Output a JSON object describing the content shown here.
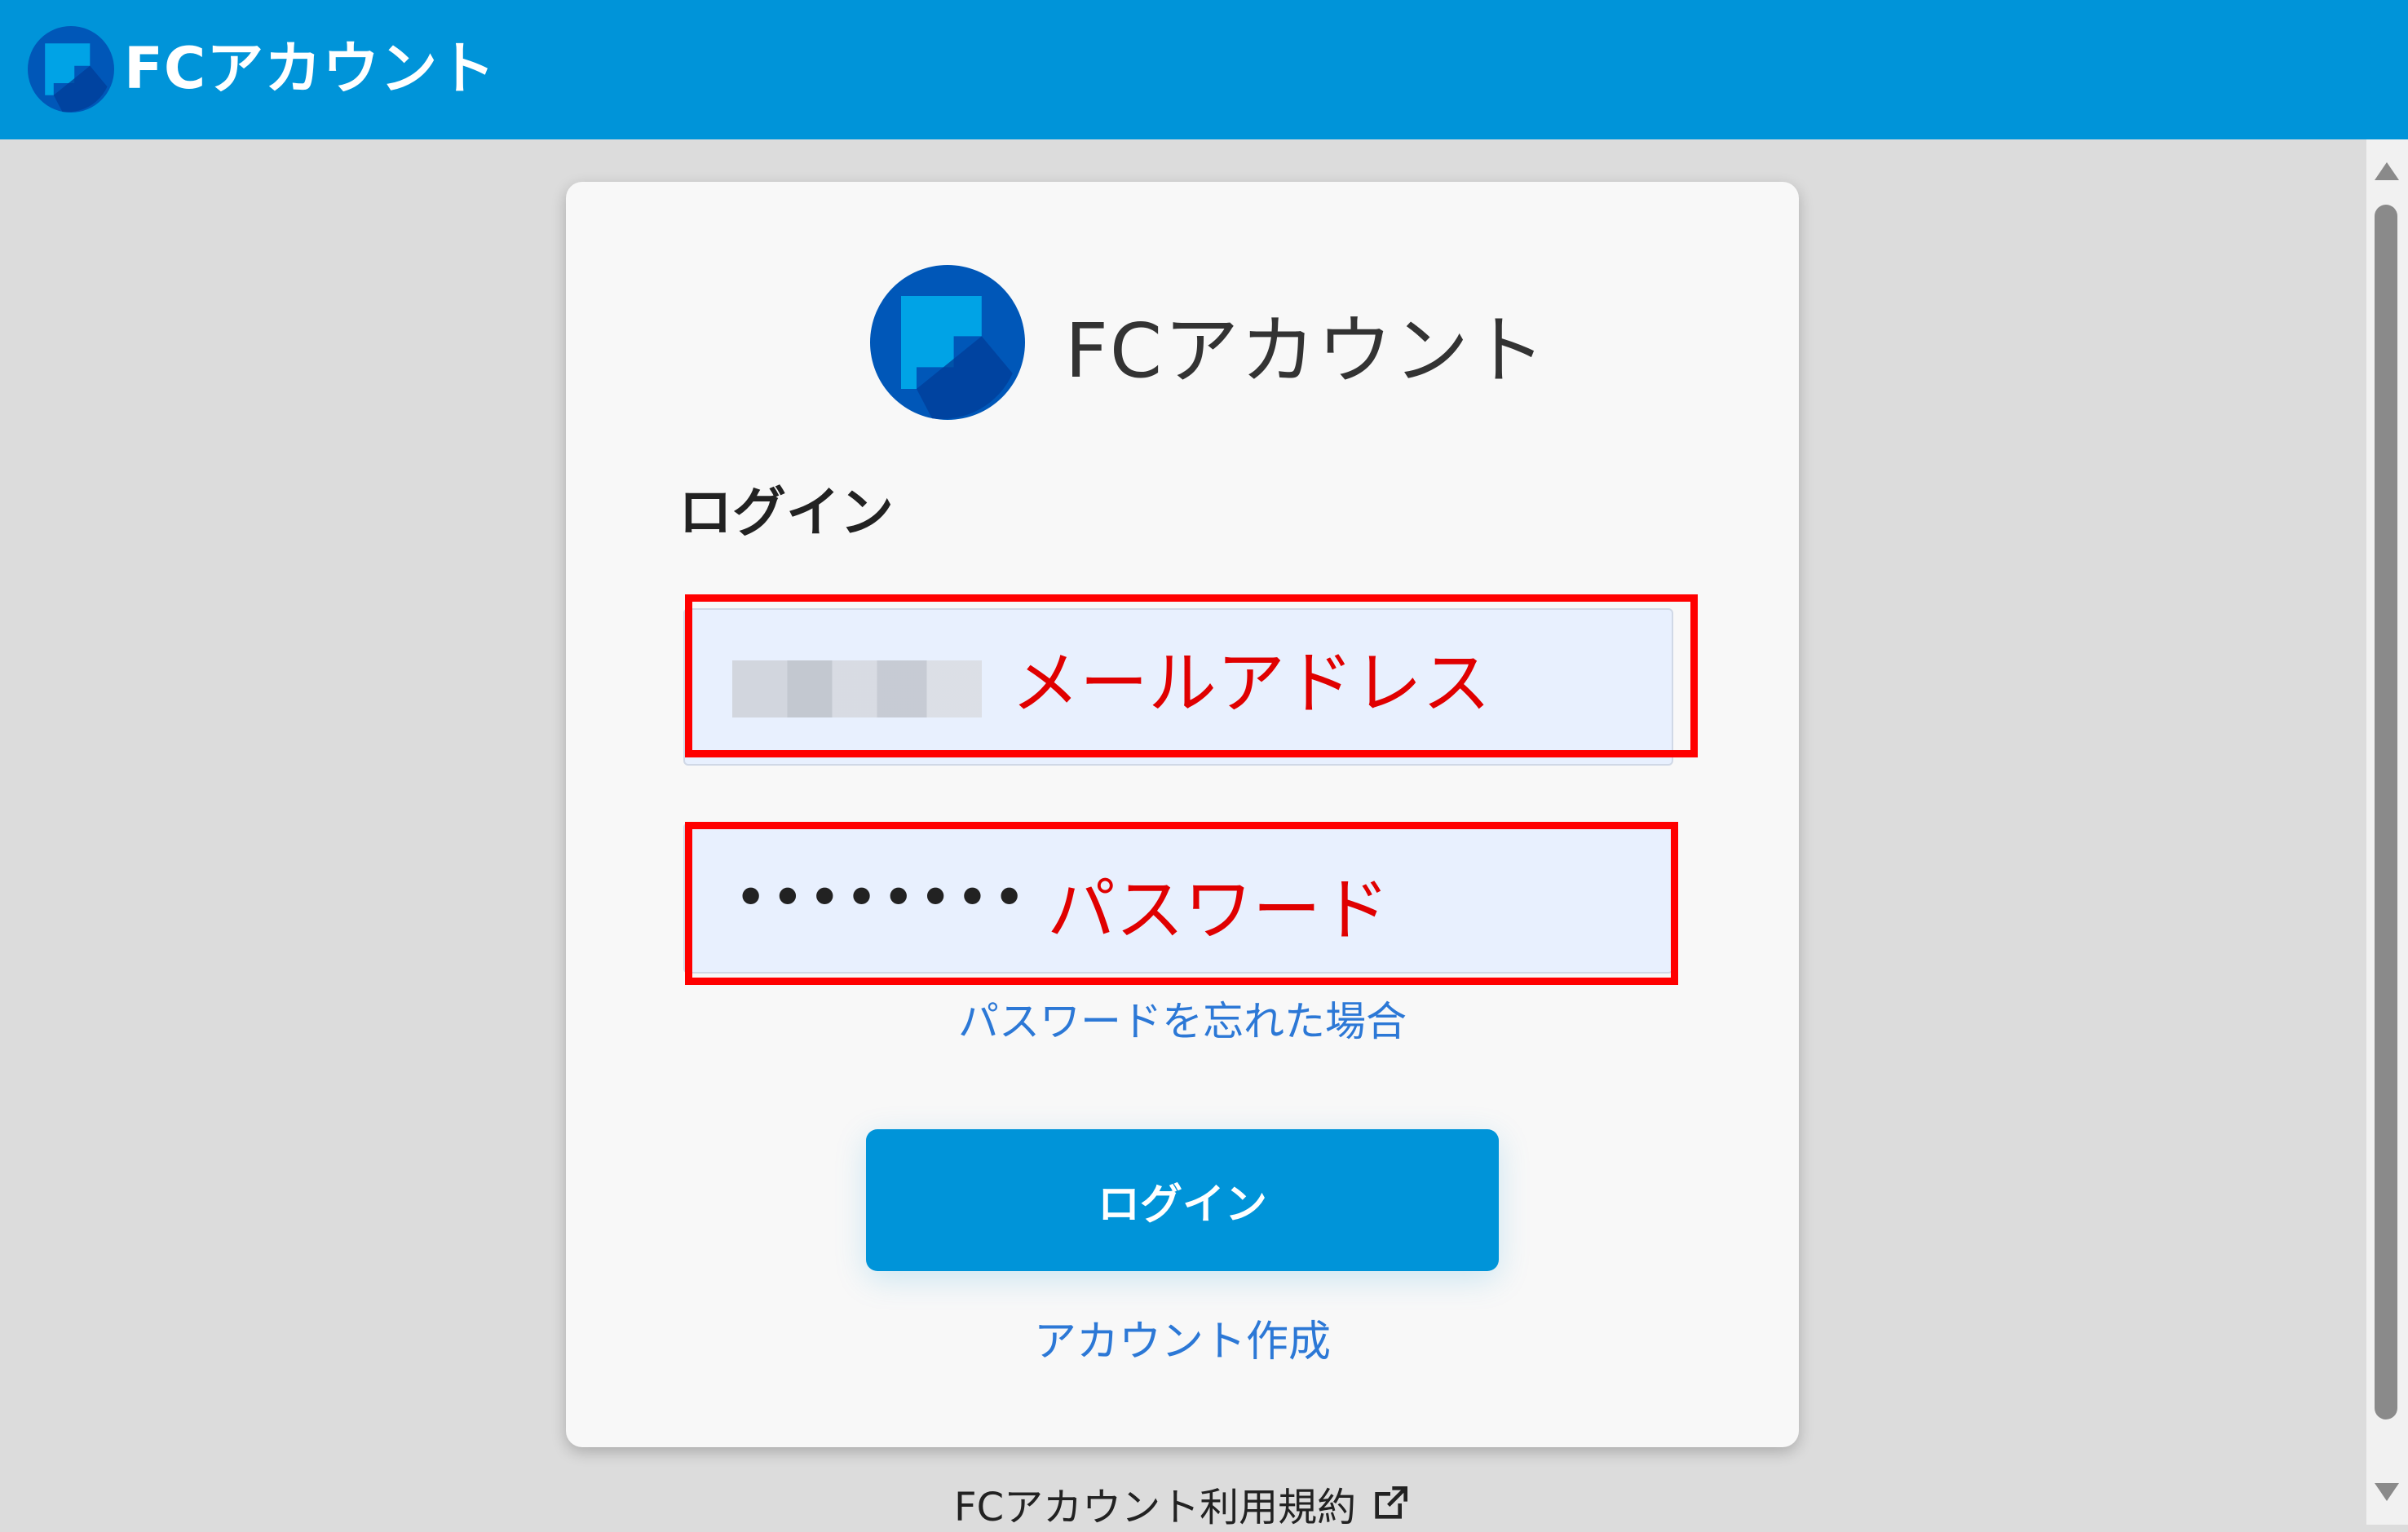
{
  "header": {
    "title": "FCアカウント"
  },
  "card": {
    "brand": "FCアカウント",
    "heading": "ログイン",
    "email_field": {
      "value": "",
      "annotation": "メールアドレス"
    },
    "password_field": {
      "value": "••••••••",
      "annotation": "パスワード"
    },
    "forgot_link": "パスワードを忘れた場合",
    "login_button": "ログイン",
    "create_account_link": "アカウント作成"
  },
  "footer": {
    "terms_link": "FCアカウント利用規約"
  },
  "colors": {
    "header": "#0094d9",
    "button": "#0094d9",
    "link": "#2c78d6",
    "annotation": "#ff0000",
    "logo_outer": "#0057b8",
    "logo_inner": "#0090d8"
  },
  "icons": {
    "logo": "fc-logo-icon",
    "external": "external-link-icon"
  }
}
